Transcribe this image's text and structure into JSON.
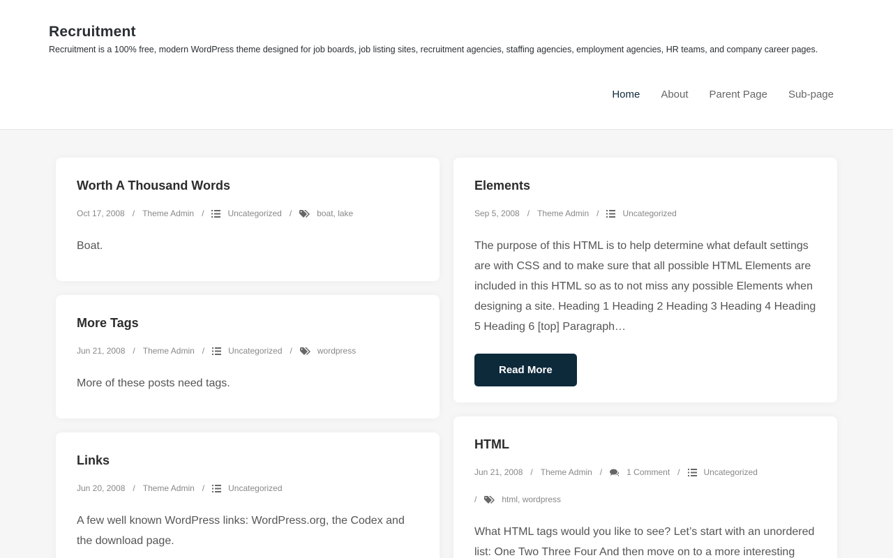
{
  "site": {
    "title": "Recruitment",
    "description": "Recruitment is a 100% free, modern WordPress theme designed for job boards, job listing sites, recruitment agencies, staffing agencies, employment agencies, HR teams, and company career pages."
  },
  "nav": [
    {
      "label": "Home"
    },
    {
      "label": "About"
    },
    {
      "label": "Parent Page"
    },
    {
      "label": "Sub-page"
    }
  ],
  "colors": {
    "accent": "#0d2a3b",
    "background": "#f6f6f6"
  },
  "icons": {
    "category": "list-icon",
    "tags": "tags-icon",
    "comments": "comments-icon"
  },
  "posts": [
    {
      "title": "Worth A Thousand Words",
      "date": "Oct 17, 2008",
      "author": "Theme Admin",
      "category": "Uncategorized",
      "tags": [
        "boat",
        "lake"
      ],
      "excerpt": "Boat."
    },
    {
      "title": "Elements",
      "date": "Sep 5, 2008",
      "author": "Theme Admin",
      "category": "Uncategorized",
      "excerpt": "The purpose of this HTML is to help determine what default settings are with CSS and to make sure that all possible HTML Elements are included in this HTML so as to not miss any possible Elements when designing a site. Heading 1 Heading 2 Heading 3 Heading 4 Heading 5 Heading 6 [top] Paragraph…",
      "read_more": "Read More"
    },
    {
      "title": "More Tags",
      "date": "Jun 21, 2008",
      "author": "Theme Admin",
      "category": "Uncategorized",
      "tags": [
        "wordpress"
      ],
      "excerpt": "More of these posts need tags."
    },
    {
      "title": "HTML",
      "date": "Jun 21, 2008",
      "author": "Theme Admin",
      "comments": "1 Comment",
      "category": "Uncategorized",
      "tags": [
        "html",
        "wordpress"
      ],
      "excerpt": "What HTML tags would you like to see? Let’s start with an unordered list: One Two Three Four And then move on to a more interesting ordered list, nested under Here and see the preformatted"
    },
    {
      "title": "Links",
      "date": "Jun 20, 2008",
      "author": "Theme Admin",
      "category": "Uncategorized",
      "excerpt": "A few well known WordPress links: WordPress.org, the Codex and the download page."
    }
  ],
  "separator": "/"
}
